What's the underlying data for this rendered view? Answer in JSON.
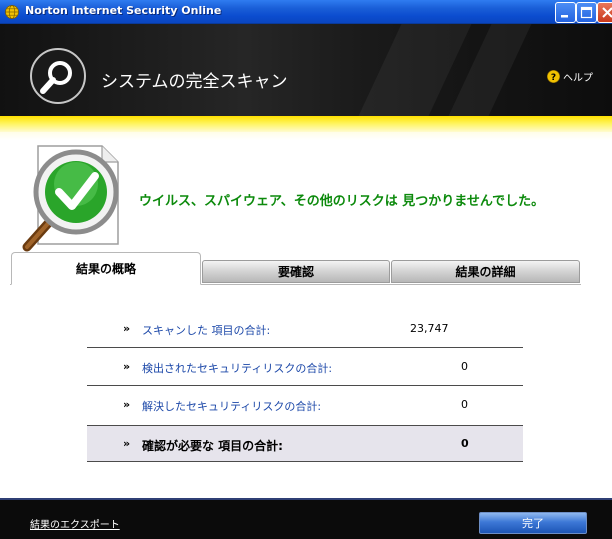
{
  "window": {
    "title": "Norton Internet Security Online",
    "title_icon": "globe-icon",
    "controls": [
      "minimize-icon",
      "maximize-icon",
      "close-icon"
    ]
  },
  "header": {
    "title": "システムの完全スキャン",
    "icon": "magnifier-icon",
    "help_label": "ヘルプ",
    "help_icon": "help-question-icon"
  },
  "result": {
    "icon": "green-checkmark-document-icon",
    "message": "ウイルス、スパイウェア、その他のリスクは 見つかりませんでした。",
    "message_color": "#0c8a0c"
  },
  "tabs": [
    {
      "label": "結果の概略",
      "active": true
    },
    {
      "label": "要確認",
      "active": false
    },
    {
      "label": "結果の詳細",
      "active": false
    }
  ],
  "summary": {
    "bullet": "»",
    "rows": [
      {
        "label": "スキャンした 項目の合計:",
        "value": "23,747"
      },
      {
        "label": "検出されたセキュリティリスクの合計:",
        "value": "0"
      },
      {
        "label": "解決したセキュリティリスクの合計:",
        "value": "0"
      },
      {
        "label": "確認が必要な 項目の合計:",
        "value": "0"
      }
    ]
  },
  "footer": {
    "export_link": "結果のエクスポート",
    "done_button": "完了"
  },
  "colors": {
    "titlebar": "#0b4ccf",
    "header_bg": "#1a1a1a",
    "accent_yellow": "#ffe100",
    "link_blue": "#1b47a8",
    "footer_bg": "#0b0b0b"
  }
}
